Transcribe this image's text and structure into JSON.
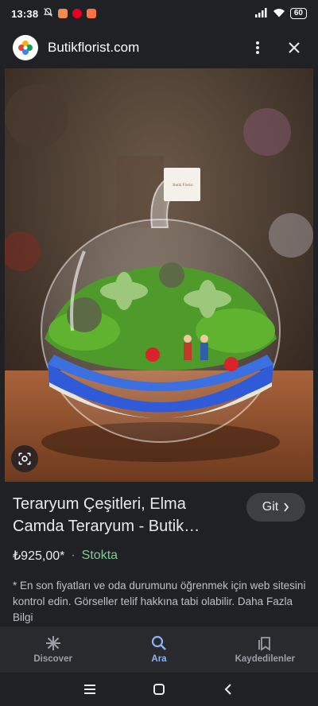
{
  "status_bar": {
    "time": "13:38",
    "battery": "60"
  },
  "header": {
    "site_name": "Butikflorist.com"
  },
  "hero": {
    "tag_text": "Butik Florist"
  },
  "product": {
    "title_line1": "Teraryum Çeşitleri, Elma",
    "title_line2": "Camda Teraryum - Butik…",
    "visit_label": "Git",
    "price": "₺925,00*",
    "separator": "·",
    "stock": "Stokta",
    "disclaimer": "* En son fiyatları ve oda durumunu öğrenmek için web sitesini kontrol edin. Görseller telif hakkına tabi olabilir.",
    "more_link": "Daha Fazla Bilgi"
  },
  "bottom_nav": {
    "items": [
      {
        "label": "Discover",
        "icon": "asterisk-icon",
        "active": false
      },
      {
        "label": "Ara",
        "icon": "search-icon",
        "active": true
      },
      {
        "label": "Kaydedilenler",
        "icon": "bookmarks-icon",
        "active": false
      }
    ]
  },
  "colors": {
    "background": "#202124",
    "accent": "#8ab4f8",
    "stock_green": "#81c995"
  }
}
